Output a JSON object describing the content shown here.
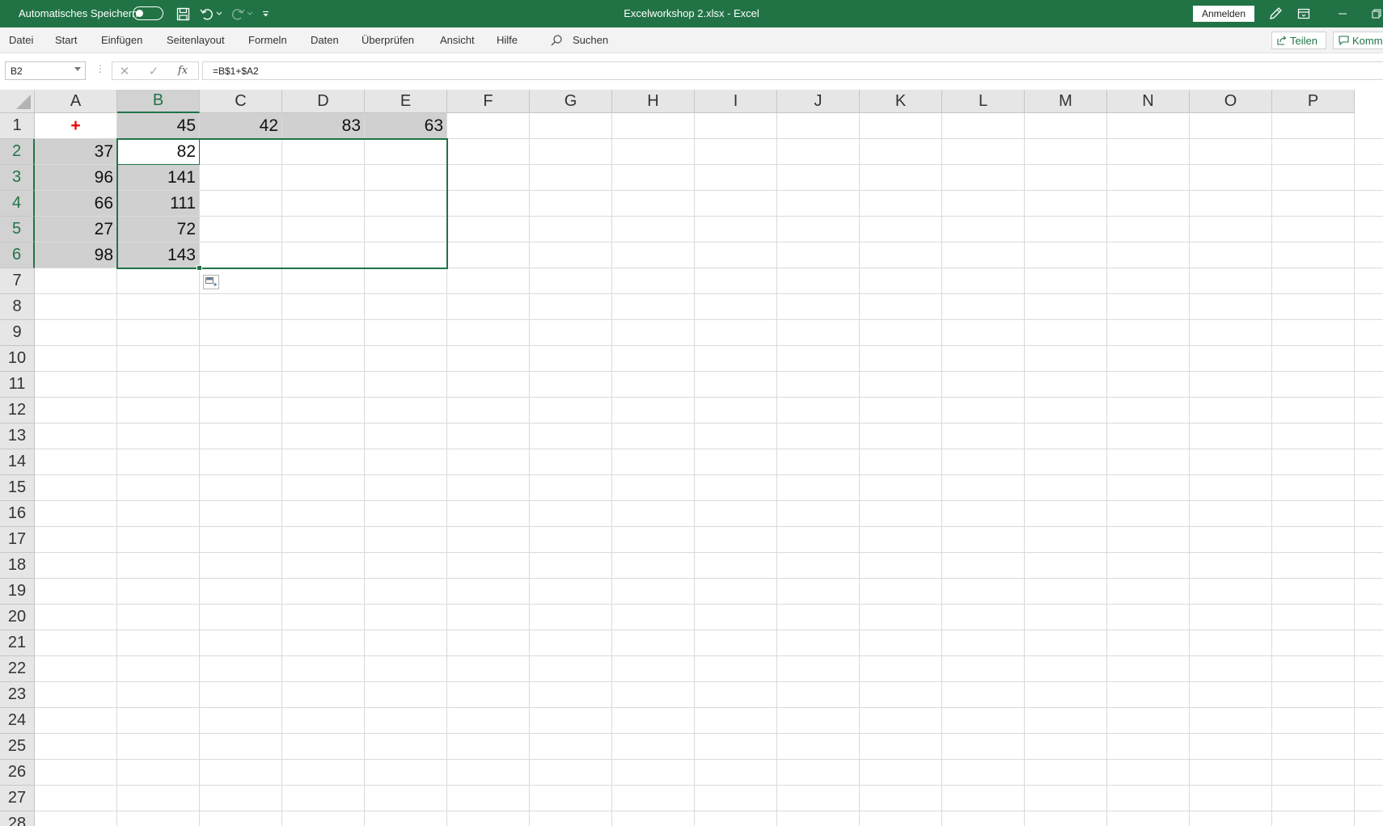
{
  "titlebar": {
    "autosave_label": "Automatisches Speichern",
    "autosave_state": "off",
    "document_title": "Excelworkshop 2.xlsx  -  Excel",
    "signin_label": "Anmelden"
  },
  "menu": {
    "items": [
      "Datei",
      "Start",
      "Einfügen",
      "Seitenlayout",
      "Formeln",
      "Daten",
      "Überprüfen",
      "Ansicht",
      "Hilfe"
    ],
    "search_label": "Suchen",
    "share_label": "Teilen",
    "comments_label": "Komm"
  },
  "formula_bar": {
    "name_box": "B2",
    "fx_label": "fx",
    "formula": "=B$1+$A2"
  },
  "grid": {
    "columns": [
      "A",
      "B",
      "C",
      "D",
      "E",
      "F",
      "G",
      "H",
      "I",
      "J",
      "K",
      "L",
      "M",
      "N",
      "O",
      "P"
    ],
    "rows": [
      "1",
      "2",
      "3",
      "4",
      "5",
      "6",
      "7",
      "8",
      "9",
      "10",
      "11",
      "12",
      "13",
      "14",
      "15",
      "16",
      "17",
      "18",
      "19",
      "20",
      "21",
      "22",
      "23",
      "24",
      "25",
      "26",
      "27",
      "28"
    ],
    "selected_column": "B",
    "selected_rows": [
      "2",
      "3",
      "4",
      "5",
      "6"
    ],
    "cells": {
      "A1": "+",
      "B1": "45",
      "C1": "42",
      "D1": "83",
      "E1": "63",
      "A2": "37",
      "A3": "96",
      "A4": "66",
      "A5": "27",
      "A6": "98",
      "B2": "82",
      "B3": "141",
      "B4": "111",
      "B5": "72",
      "B6": "143"
    },
    "gray_cells": [
      "B1",
      "C1",
      "D1",
      "E1",
      "A2",
      "A3",
      "A4",
      "A5",
      "A6",
      "B3",
      "B4",
      "B5",
      "B6"
    ],
    "colors": {
      "accent": "#217346",
      "fill_gray": "#d0d0d0",
      "plus_red": "#e00000"
    }
  }
}
